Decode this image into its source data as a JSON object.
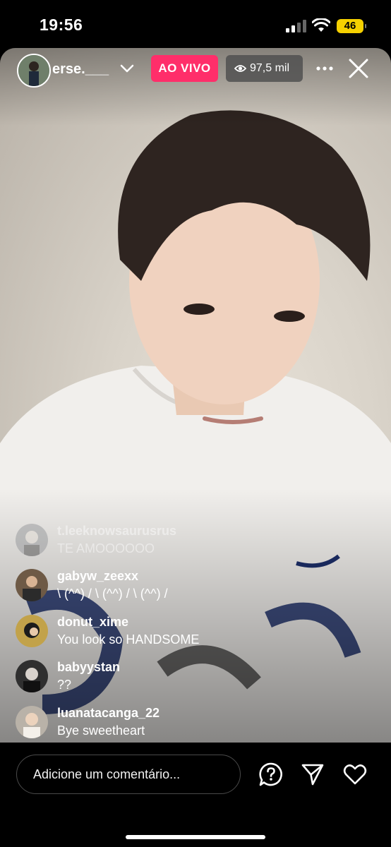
{
  "status_bar": {
    "time": "19:56",
    "battery": "46"
  },
  "live": {
    "host_username": "erse.___",
    "live_badge": "AO VIVO",
    "viewer_count": "97,5 mil"
  },
  "comments": [
    {
      "username": "t.leeknowsaurusrus",
      "text": "TE AMOOOOOO",
      "faded": true
    },
    {
      "username": "gabyw_zeexx",
      "text": "\\ (^^) / \\ (^^) / \\ (^^) /"
    },
    {
      "username": "donut_xime",
      "text": "You look so HANDSOME"
    },
    {
      "username": "babyystan",
      "text": "??"
    },
    {
      "username": "luanatacanga_22",
      "text": "Bye sweetheart"
    }
  ],
  "bottom_bar": {
    "comment_placeholder": "Adicione um comentário..."
  },
  "icons": [
    "signal-icon",
    "wifi-icon",
    "battery-icon",
    "chevron-down-icon",
    "eye-icon",
    "more-icon",
    "close-icon",
    "question-icon",
    "send-icon",
    "heart-icon"
  ]
}
